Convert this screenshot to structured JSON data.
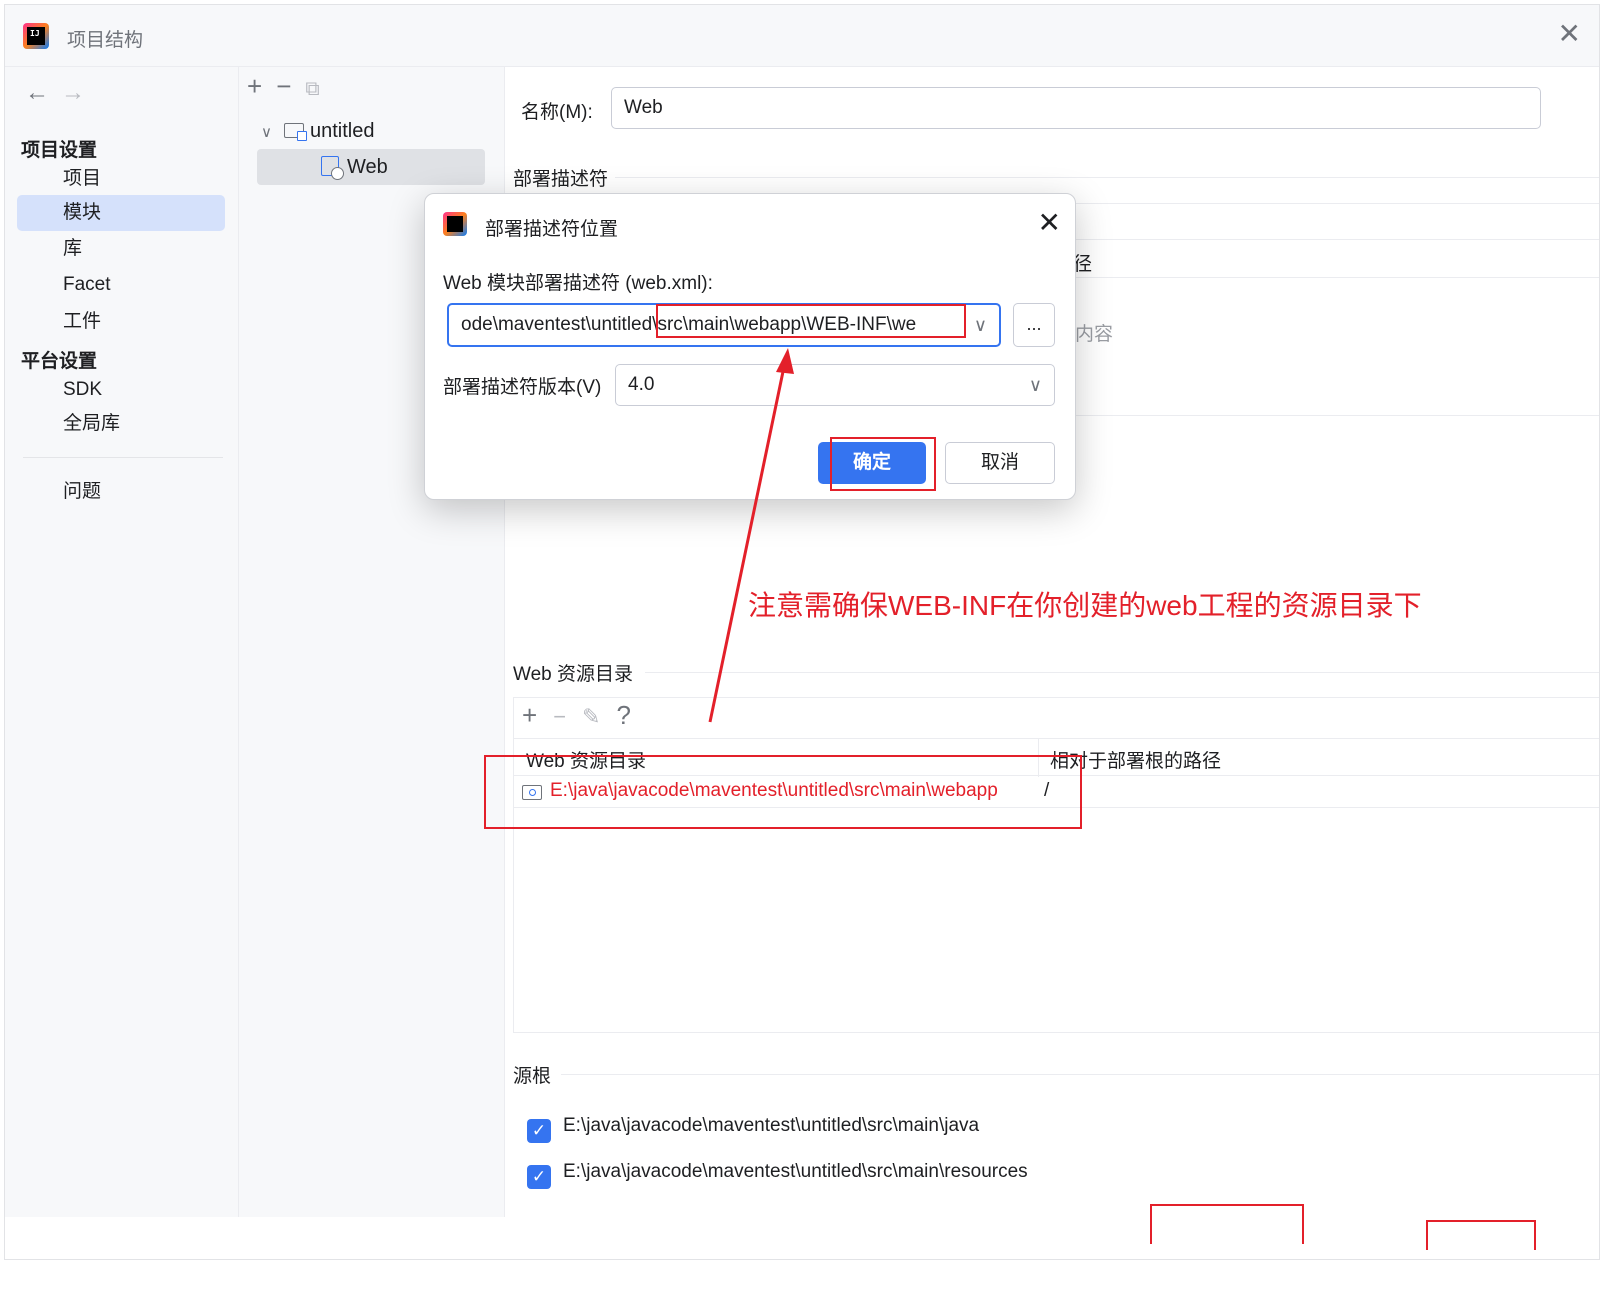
{
  "window": {
    "title": "项目结构"
  },
  "sidebar": {
    "project_settings_label": "项目设置",
    "items_project": [
      {
        "label": "项目",
        "selected": false
      },
      {
        "label": "模块",
        "selected": true
      },
      {
        "label": "库",
        "selected": false
      },
      {
        "label": "Facet",
        "selected": false
      },
      {
        "label": "工件",
        "selected": false
      }
    ],
    "platform_settings_label": "平台设置",
    "items_platform": [
      {
        "label": "SDK"
      },
      {
        "label": "全局库"
      }
    ],
    "problems_label": "问题"
  },
  "tree": {
    "root_label": "untitled",
    "child_label": "Web"
  },
  "main": {
    "name_label": "名称(M):",
    "name_value": "Web",
    "deploy_descriptor_title": "部署描述符",
    "peek_path_fragment": "径",
    "peek_content_fragment": "内容",
    "web_resource_title": "Web 资源目录",
    "table": {
      "col1": "Web 资源目录",
      "col2": "相对于部署根的路径",
      "row_path": "E:\\java\\javacode\\maventest\\untitled\\src\\main\\webapp",
      "row_rel": "/"
    },
    "source_roots_title": "源根",
    "source_roots": [
      {
        "path": "E:\\java\\javacode\\maventest\\untitled\\src\\main\\java",
        "checked": true
      },
      {
        "path": "E:\\java\\javacode\\maventest\\untitled\\src\\main\\resources",
        "checked": true
      }
    ]
  },
  "dialog": {
    "title": "部署描述符位置",
    "descriptor_label": "Web 模块部署描述符 (web.xml):",
    "descriptor_value": "ode\\maventest\\untitled\\src\\main\\webapp\\WEB-INF\\we",
    "browse_label": "...",
    "version_label": "部署描述符版本(V)",
    "version_value": "4.0",
    "ok_label": "确定",
    "cancel_label": "取消"
  },
  "annotation": {
    "note": "注意需确保WEB-INF在你创建的web工程的资源目录下",
    "color": "#e3202a"
  },
  "colors": {
    "accent": "#3574f0",
    "selection": "#d5e1fb",
    "annotation_red": "#e3202a"
  }
}
